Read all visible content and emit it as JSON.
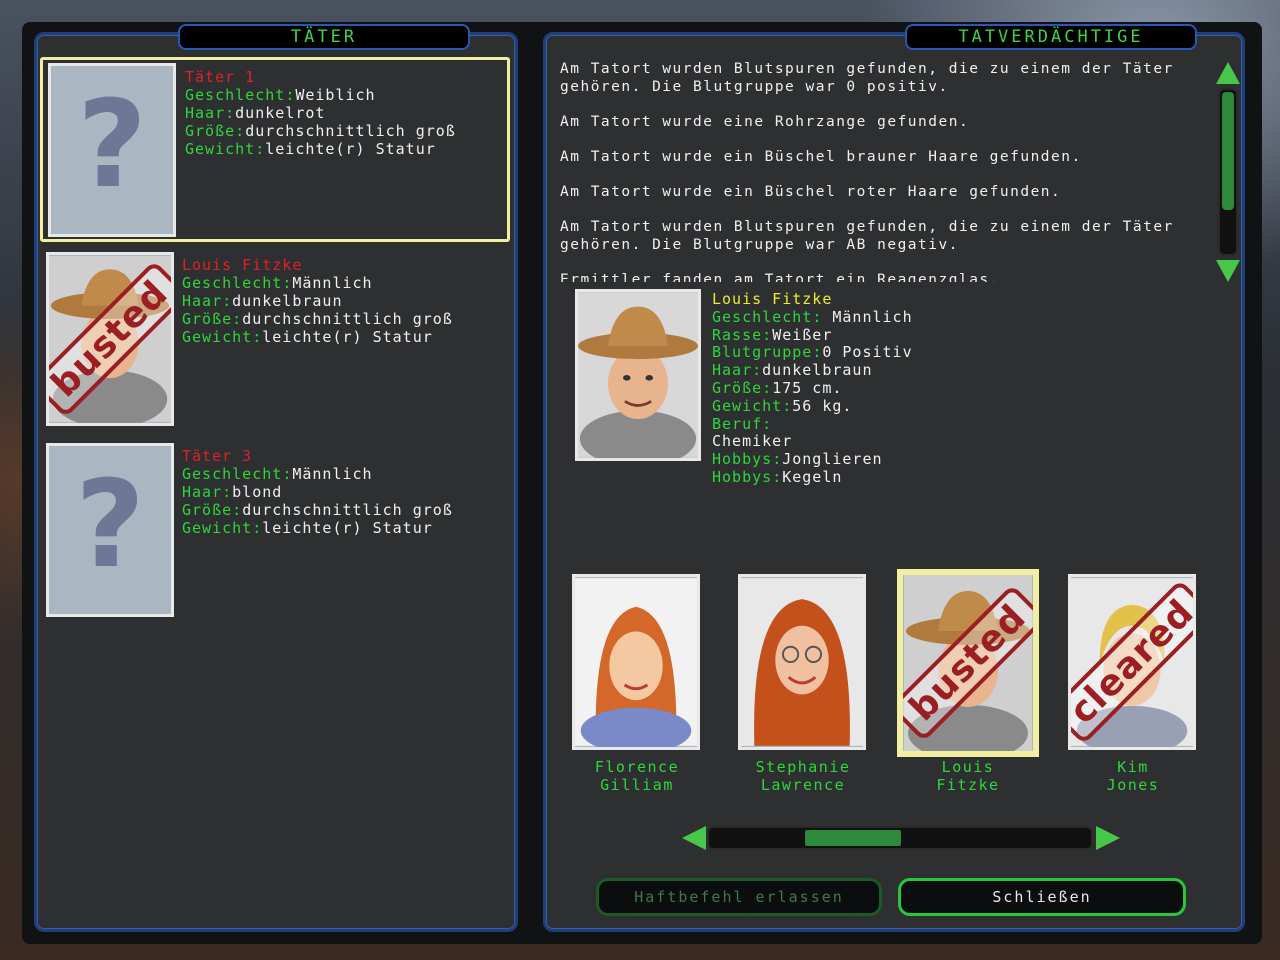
{
  "tabs": {
    "left": "TÄTER",
    "right": "TATVERDÄCHTIGE"
  },
  "perpetrators": [
    {
      "title": "Täter 1",
      "selected": true,
      "portrait": "unknown",
      "fields": [
        {
          "label": "Geschlecht",
          "value": "Weiblich"
        },
        {
          "label": "Haar",
          "value": "dunkelrot"
        },
        {
          "label": "Größe",
          "value": "durchschnittlich groß"
        },
        {
          "label": "Gewicht",
          "value": "leichte(r) Statur"
        }
      ]
    },
    {
      "title": "Louis Fitzke",
      "selected": false,
      "portrait": "cowboy",
      "stamp": "busted",
      "fields": [
        {
          "label": "Geschlecht",
          "value": "Männlich"
        },
        {
          "label": "Haar",
          "value": "dunkelbraun"
        },
        {
          "label": "Größe",
          "value": "durchschnittlich groß"
        },
        {
          "label": "Gewicht",
          "value": "leichte(r) Statur"
        }
      ]
    },
    {
      "title": "Täter 3",
      "selected": false,
      "portrait": "unknown",
      "fields": [
        {
          "label": "Geschlecht",
          "value": "Männlich"
        },
        {
          "label": "Haar",
          "value": "blond"
        },
        {
          "label": "Größe",
          "value": "durchschnittlich groß"
        },
        {
          "label": "Gewicht",
          "value": "leichte(r) Statur"
        }
      ]
    }
  ],
  "evidence": [
    "Am Tatort wurden Blutspuren gefunden, die zu einem der Täter gehören. Die Blutgruppe war 0 positiv.",
    "Am Tatort wurde eine Rohrzange gefunden.",
    "Am Tatort wurde ein Büschel brauner Haare gefunden.",
    "Am Tatort wurde ein Büschel roter Haare gefunden.",
    "Am Tatort wurden Blutspuren gefunden, die zu einem der Täter gehören. Die Blutgruppe war AB negativ.",
    "Ermittler fanden am Tatort ein Reagenzglas."
  ],
  "detail": {
    "name": "Louis Fitzke",
    "fields": [
      {
        "label": "Geschlecht",
        "value": " Männlich"
      },
      {
        "label": "Rasse",
        "value": "Weißer"
      },
      {
        "label": "Blutgruppe",
        "value": "0 Positiv"
      },
      {
        "label": "Haar",
        "value": "dunkelbraun"
      },
      {
        "label": "Größe",
        "value": "175 cm."
      },
      {
        "label": "Gewicht",
        "value": "56 kg."
      },
      {
        "label": "Beruf",
        "value": ""
      }
    ],
    "beruf_value": "Chemiker",
    "hobbies": [
      {
        "label": "Hobbys",
        "value": "Jonglieren"
      },
      {
        "label": "Hobbys",
        "value": "Kegeln"
      }
    ]
  },
  "suspects": [
    {
      "first": "Florence",
      "last": "Gilliam",
      "stamp": "",
      "selected": false,
      "portrait": "redhead-girl"
    },
    {
      "first": "Stephanie",
      "last": "Lawrence",
      "stamp": "",
      "selected": false,
      "portrait": "redhead-glasses"
    },
    {
      "first": "Louis",
      "last": "Fitzke",
      "stamp": "busted",
      "selected": true,
      "portrait": "cowboy"
    },
    {
      "first": "Kim",
      "last": "Jones",
      "stamp": "cleared",
      "selected": false,
      "portrait": "blond"
    }
  ],
  "buttons": {
    "warrant": "Haftbefehl erlassen",
    "close": "Schließen"
  },
  "colors": {
    "label_green": "#2fd63a",
    "title_red": "#e02028",
    "name_yellow": "#ecec2a",
    "panel_border": "#1f3f7a",
    "selection": "#f3efa0"
  }
}
